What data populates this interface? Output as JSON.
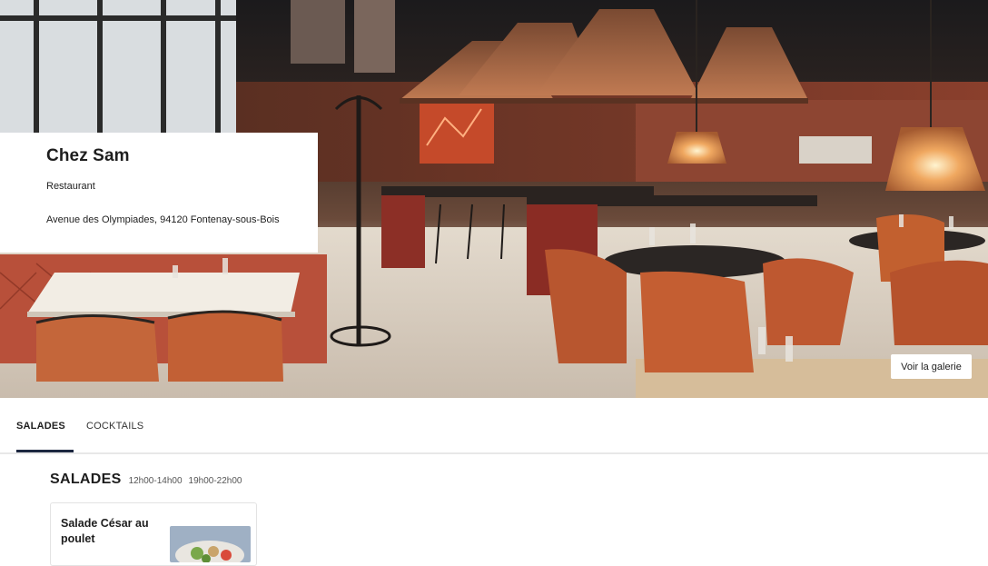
{
  "restaurant": {
    "name": "Chez Sam",
    "type": "Restaurant",
    "address": "Avenue des Olympiades, 94120 Fontenay-sous-Bois"
  },
  "hero": {
    "gallery_button": "Voir la galerie"
  },
  "tabs": [
    {
      "label": "SALADES",
      "active": true
    },
    {
      "label": "COCKTAILS",
      "active": false
    }
  ],
  "section": {
    "title": "SALADES",
    "hours": [
      "12h00-14h00",
      "19h00-22h00"
    ]
  },
  "dishes": [
    {
      "name": "Salade César au poulet"
    }
  ],
  "colors": {
    "accent": "#1c2740",
    "card_border": "#e3e3e3",
    "tab_divider": "#e8e8e8"
  }
}
